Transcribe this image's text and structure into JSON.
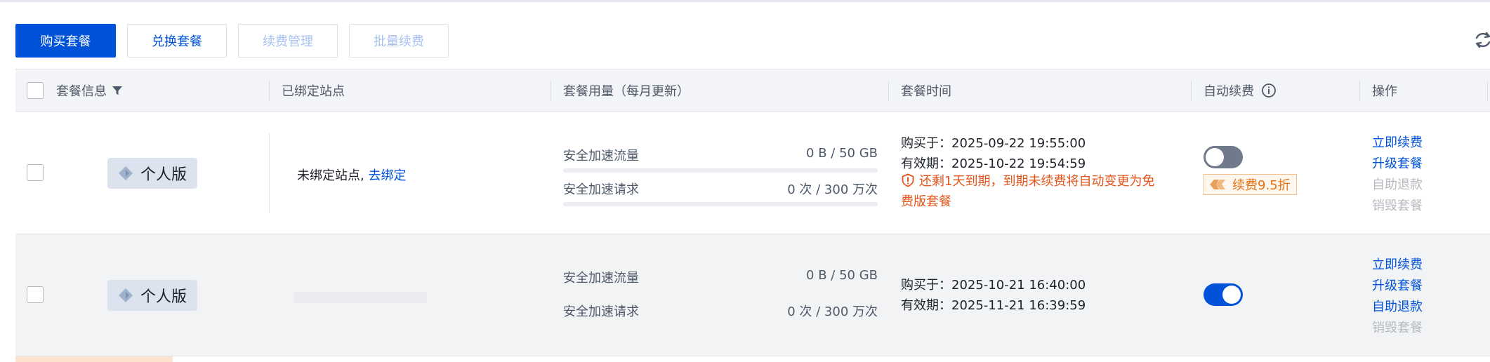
{
  "toolbar": {
    "buy_label": "购买套餐",
    "redeem_label": "兑换套餐",
    "renew_manage_label": "续费管理",
    "batch_renew_label": "批量续费"
  },
  "table": {
    "columns": {
      "plan_info": "套餐信息",
      "bound_sites": "已绑定站点",
      "usage": "套餐用量（每月更新）",
      "time": "套餐时间",
      "auto_renew": "自动续费",
      "actions": "操作"
    },
    "rows": [
      {
        "plan": "个人版",
        "site_text": "未绑定站点, ",
        "site_link": "去绑定",
        "usage_traffic_label": "安全加速流量",
        "usage_traffic_value": "0 B / 50 GB",
        "usage_requests_label": "安全加速请求",
        "usage_requests_value": "0 次 / 300 万次",
        "purchased": "购买于：2025-09-22 19:55:00",
        "valid": "有效期：2025-10-22 19:54:59",
        "warning_line1": "还剩1天到期，到期未续费将自动变更为免",
        "warning_line2": "费版套餐",
        "auto_renew": false,
        "discount": "续费9.5折",
        "actions": [
          "立即续费",
          "升级套餐",
          "自助退款",
          "销毁套餐"
        ]
      },
      {
        "plan": "个人版",
        "usage_traffic_label": "安全加速流量",
        "usage_traffic_value": "0 B / 50 GB",
        "usage_requests_label": "安全加速请求",
        "usage_requests_value": "0 次 / 300 万次",
        "purchased": "购买于：2025-10-21 16:40:00",
        "valid": "有效期：2025-11-21 16:39:59",
        "auto_renew": true,
        "actions": [
          "立即续费",
          "升级套餐",
          "自助退款",
          "销毁套餐"
        ]
      }
    ]
  },
  "colors": {
    "primary": "#0052d9",
    "warning": "#e3551a",
    "disabled_text": "#b6b9bf"
  }
}
